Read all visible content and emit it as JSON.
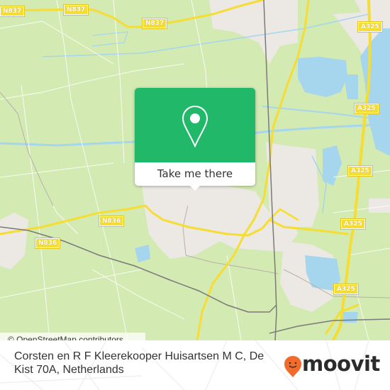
{
  "map": {
    "colors": {
      "land": "#d4eab3",
      "urban": "#ece8e4",
      "water": "#a6d5ee",
      "major_road": "#f5dd34",
      "railway": "#7a7a7a",
      "minor_road": "#ffffff"
    },
    "road_labels": [
      {
        "id": "n837-west",
        "text": "N837"
      },
      {
        "id": "n837-center",
        "text": "N837"
      },
      {
        "id": "n837-east",
        "text": "N837"
      },
      {
        "id": "a325-north",
        "text": "A325"
      },
      {
        "id": "a325-mid",
        "text": "A325"
      },
      {
        "id": "a325-east",
        "text": "A325"
      },
      {
        "id": "a325-south1",
        "text": "A325"
      },
      {
        "id": "a325-south2",
        "text": "A325"
      },
      {
        "id": "n836-east",
        "text": "N836"
      },
      {
        "id": "n836-west",
        "text": "N836"
      }
    ],
    "attribution": "© OpenStreetMap contributors"
  },
  "popup": {
    "icon": "location-pin-icon",
    "action_label": "Take me there",
    "accent_color": "#22b86a"
  },
  "footer": {
    "address": "Corsten en R F Kleerekooper Huisartsen M C, De Kist 70A, Netherlands",
    "brand": "moovit",
    "brand_icon": "moovit-pin-icon",
    "brand_color": "#f26b2a"
  }
}
